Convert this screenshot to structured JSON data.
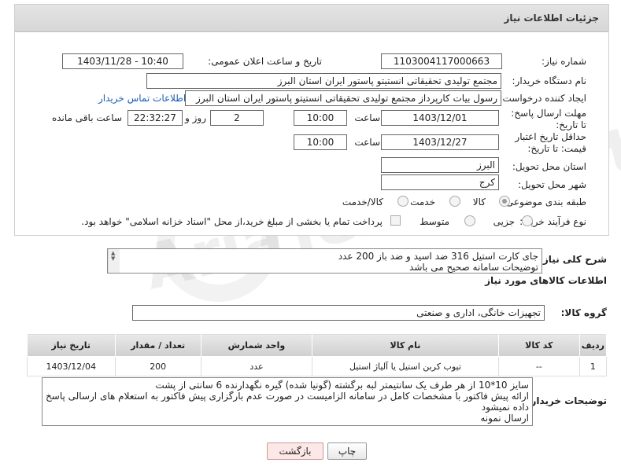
{
  "panel": {
    "title": "جزئیات اطلاعات نیاز"
  },
  "form": {
    "need_number_label": "شماره نیاز:",
    "need_number": "1103004117000663",
    "announce_label": "تاریخ و ساعت اعلان عمومی:",
    "announce_value": "1403/11/28 - 10:40",
    "buyer_label": "نام دستگاه خریدار:",
    "buyer_value": "مجتمع تولیدی تحقیقاتی انستیتو پاستور ایران استان البرز",
    "creator_label": "ایجاد کننده درخواست:",
    "creator_value": "رسول بیات کارپرداز مجتمع تولیدی تحقیقاتی انستیتو پاستور ایران استان البرز",
    "contact_link": "اطلاعات تماس خریدار",
    "deadline_label": "مهلت ارسال پاسخ: تا تاریخ:",
    "deadline_date": "1403/12/01",
    "time_label": "ساعت",
    "deadline_time": "10:00",
    "days_value": "2",
    "days_label": "روز و",
    "remaining_time": "22:32:27",
    "remaining_label": "ساعت باقی مانده",
    "min_price_label": "حداقل تاریخ اعتبار قیمت: تا تاریخ:",
    "min_price_date": "1403/12/27",
    "min_price_time": "10:00",
    "province_label": "استان محل تحویل:",
    "province_value": "البرز",
    "city_label": "شهر محل تحویل:",
    "city_value": "کرج",
    "category_label": "طبقه بندی موضوعی:",
    "category_options": [
      "کالا",
      "خدمت",
      "کالا/خدمت"
    ],
    "purchase_label": "نوع فرآیند خرید :",
    "purchase_options": [
      "جزیی",
      "متوسط"
    ],
    "payment_note": "پرداخت تمام یا بخشی از مبلغ خرید،از محل \"اسناد خزانه اسلامی\" خواهد بود."
  },
  "summary": {
    "label": "شرح کلی نیاز:",
    "line1": "جای کارت استیل 316  ضد اسید و ضد باز  200 عدد",
    "line2": "توضیحات سامانه صحیح می باشد"
  },
  "items_section": {
    "title": "اطلاعات کالاهای مورد نیاز",
    "group_label": "گروه کالا:",
    "group_value": "تجهیزات خانگی، اداری و صنعتی"
  },
  "table": {
    "headers": [
      "ردیف",
      "کد کالا",
      "نام کالا",
      "واحد شمارش",
      "تعداد / مقدار",
      "تاریخ نیاز"
    ],
    "rows": [
      [
        "1",
        "--",
        "تیوب کربن استیل یا آلیاژ استیل",
        "عدد",
        "200",
        "1403/12/04"
      ]
    ]
  },
  "buyer_notes": {
    "label": "توضیحات خریدار:",
    "line1": "سایز 10*10 از هر طرف یک سانتیمتر لبه برگشته (گونیا شده) گیره نگهدارنده 6 سانتی از پشت",
    "line2": "ارائه پیش فاکتور با مشخصات کامل در سامانه الزامیست در صورت عدم بارگزاری پیش فاکتور به استعلام های ارسالی پاسخ داده نمیشود",
    "line3": "ارسال نمونه"
  },
  "buttons": {
    "print": "چاپ",
    "back": "بازگشت"
  },
  "watermark": "AriaTender.net"
}
